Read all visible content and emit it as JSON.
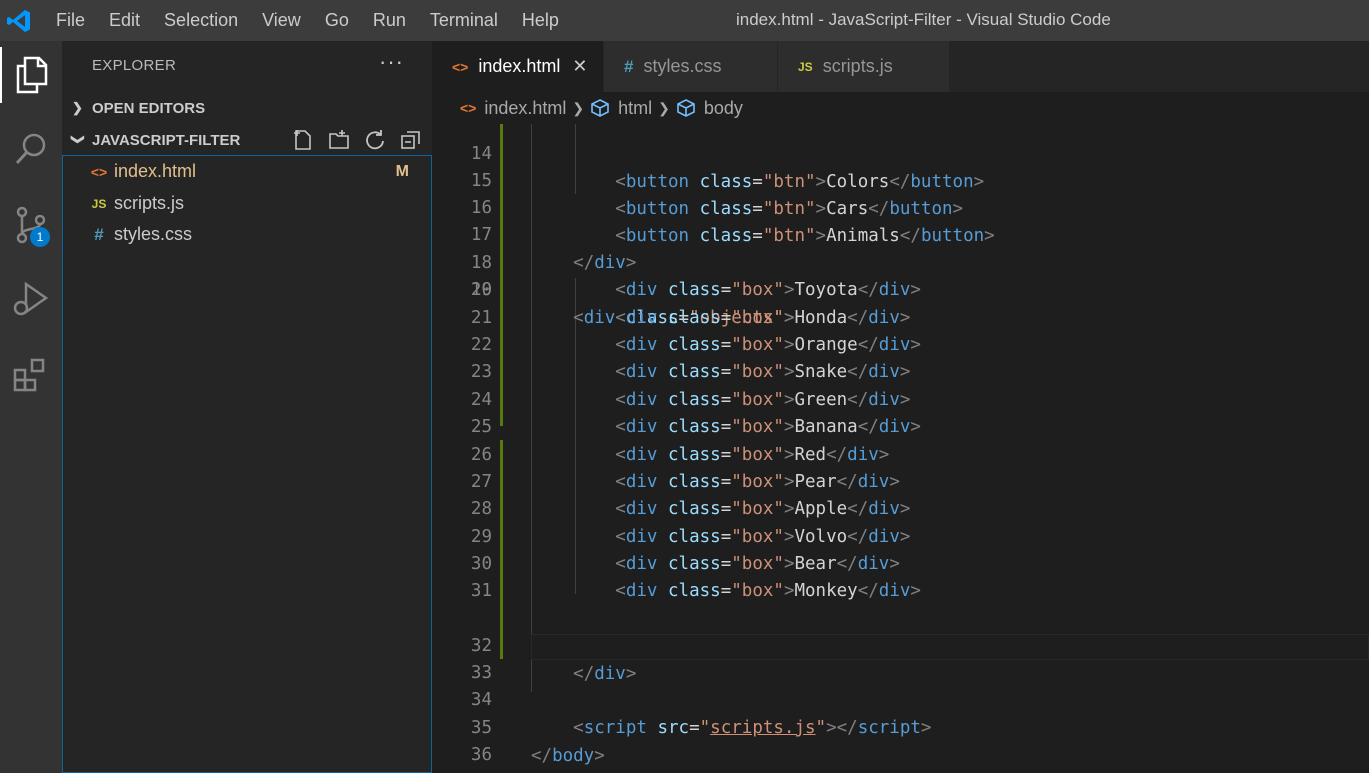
{
  "menu": [
    "File",
    "Edit",
    "Selection",
    "View",
    "Go",
    "Run",
    "Terminal",
    "Help"
  ],
  "window_title": "index.html - JavaScript-Filter - Visual Studio Code",
  "activity": {
    "scm_badge": "1"
  },
  "sidebar": {
    "header": "EXPLORER",
    "more": "···",
    "open_editors": "OPEN EDITORS",
    "folder": "JAVASCRIPT-FILTER",
    "files": [
      {
        "name": "index.html",
        "icon": "<>",
        "modified": "M"
      },
      {
        "name": "scripts.js",
        "icon": "JS",
        "modified": ""
      },
      {
        "name": "styles.css",
        "icon": "#",
        "modified": ""
      }
    ]
  },
  "tabs": [
    {
      "label": "index.html",
      "icon": "<>",
      "active": true,
      "close": "✕"
    },
    {
      "label": "styles.css",
      "icon": "#",
      "active": false
    },
    {
      "label": "scripts.js",
      "icon": "JS",
      "active": false
    }
  ],
  "breadcrumb": [
    "index.html",
    "html",
    "body"
  ],
  "code": {
    "line_numbers": [
      "14",
      "15",
      "16",
      "17",
      "18",
      "19",
      "20",
      "21",
      "22",
      "23",
      "24",
      "25",
      "26",
      "27",
      "28",
      "29",
      "30",
      "31",
      "32",
      "33",
      "34",
      "35",
      "36"
    ],
    "buttons": [
      {
        "text": "Colors"
      },
      {
        "text": "Cars"
      },
      {
        "text": "Animals"
      }
    ],
    "objects_class": "objects",
    "boxes": [
      "Toyota",
      "Honda",
      "Orange",
      "Snake",
      "Green",
      "Banana",
      "Red",
      "Pear",
      "Apple",
      "Volvo",
      "Bear",
      "Monkey"
    ],
    "btn_class": "btn",
    "box_class": "box",
    "script_src": "scripts.js"
  },
  "colors": {
    "accent": "#007acc",
    "tag": "#569cd6",
    "attr": "#9cdcfe",
    "string": "#ce9178",
    "bracket": "#808080",
    "modified": "#e2c08d",
    "js": "#cbcb41",
    "html_icon": "#e37933",
    "css_icon": "#519aba"
  }
}
